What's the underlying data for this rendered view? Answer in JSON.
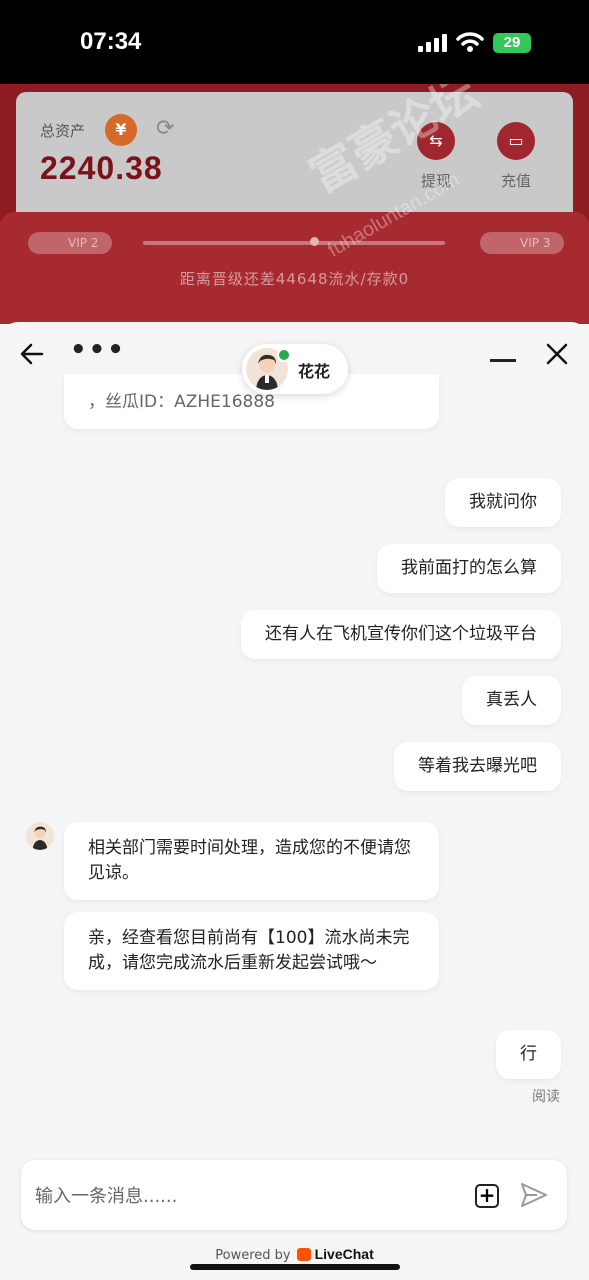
{
  "status": {
    "time": "07:34",
    "battery": "29"
  },
  "background_app": {
    "asset_label": "总资产",
    "asset_value": "2240.38",
    "yen_symbol": "¥",
    "withdraw_label": "提现",
    "deposit_label": "充值",
    "vip_current": "VIP 2",
    "vip_next": "VIP 3",
    "vip_progress_text": "距离晋级还差44648流水/存款0",
    "watermark": "富豪论坛",
    "watermark_url": "fuhaoluntan.com"
  },
  "chat": {
    "agent_name": "花花",
    "messages": [
      {
        "from": "agent",
        "text": "，丝瓜ID：AZHE16888"
      },
      {
        "from": "user",
        "text": "我就问你"
      },
      {
        "from": "user",
        "text": "我前面打的怎么算"
      },
      {
        "from": "user",
        "text": "还有人在飞机宣传你们这个垃圾平台"
      },
      {
        "from": "user",
        "text": "真丢人"
      },
      {
        "from": "user",
        "text": "等着我去曝光吧"
      },
      {
        "from": "agent",
        "text": "相关部门需要时间处理，造成您的不便请您见谅。"
      },
      {
        "from": "agent",
        "text": "亲，经查看您目前尚有【100】流水尚未完成，请您完成流水后重新发起尝试哦～"
      },
      {
        "from": "user",
        "text": "行"
      }
    ],
    "read_status": "阅读",
    "input_placeholder": "输入一条消息......",
    "powered_by": "Powered by",
    "brand": "LiveChat"
  }
}
